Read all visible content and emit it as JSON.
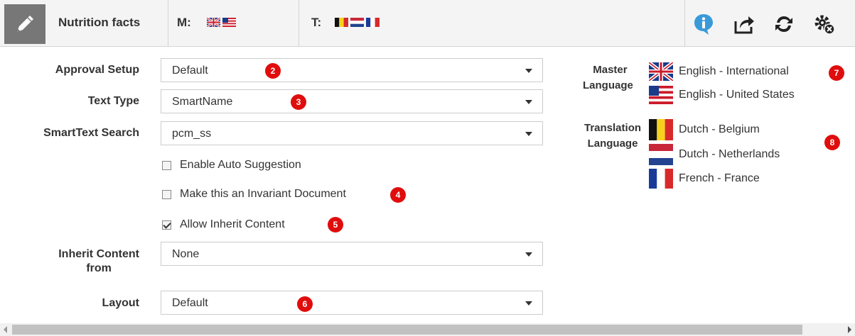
{
  "header": {
    "title": "Nutrition facts",
    "master_label": "M:",
    "translation_label": "T:",
    "master_flags": [
      "uk-flag-icon",
      "us-flag-icon"
    ],
    "translation_flags": [
      "belgium-flag-icon",
      "netherlands-flag-icon",
      "france-flag-icon"
    ],
    "actions": [
      "info-icon",
      "share-icon",
      "refresh-icon",
      "settings-remove-icon"
    ],
    "accent_color": "#3a9ad9"
  },
  "form": {
    "approval_setup": {
      "label": "Approval Setup",
      "value": "Default"
    },
    "text_type": {
      "label": "Text Type",
      "value": "SmartName"
    },
    "smarttext_search": {
      "label": "SmartText Search",
      "value": "pcm_ss"
    },
    "enable_auto_suggestion": {
      "label": "Enable Auto Suggestion",
      "checked": false
    },
    "invariant_document": {
      "label": "Make this an Invariant Document",
      "checked": false
    },
    "allow_inherit": {
      "label": "Allow Inherit Content",
      "checked": true
    },
    "inherit_content_from": {
      "label_line1": "Inherit Content",
      "label_line2": "from",
      "value": "None"
    },
    "layout": {
      "label": "Layout",
      "value": "Default"
    }
  },
  "languages": {
    "master_heading_line1": "Master",
    "master_heading_line2": "Language",
    "master": [
      "English - International",
      "English - United States"
    ],
    "translation_heading_line1": "Translation",
    "translation_heading_line2": "Language",
    "translation": [
      "Dutch - Belgium",
      "Dutch - Netherlands",
      "French - France"
    ]
  },
  "badges": [
    "2",
    "3",
    "4",
    "5",
    "6",
    "7",
    "8"
  ],
  "badge_color": "#e00d0d"
}
